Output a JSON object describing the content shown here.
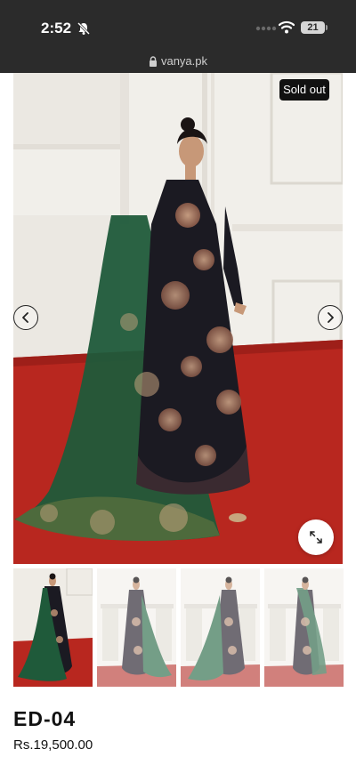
{
  "status_bar": {
    "time": "2:52",
    "battery": "21",
    "icons": [
      "bell-slash-icon",
      "cellular-dots-icon",
      "wifi-icon",
      "battery-icon"
    ]
  },
  "browser": {
    "url": "vanya.pk",
    "icon": "lock-icon"
  },
  "gallery": {
    "badge": "Sold out",
    "prev_icon": "chevron-left-icon",
    "next_icon": "chevron-right-icon",
    "zoom_icon": "expand-icon",
    "thumbnail_count": 4
  },
  "product": {
    "title": "ED-04",
    "price": "Rs.19,500.00"
  },
  "colors": {
    "dress": "#1b1a22",
    "dupatta": "#1f5a3a",
    "carpet": "#b8271f",
    "wall": "#f1efea",
    "embroidery": "#c79878"
  }
}
